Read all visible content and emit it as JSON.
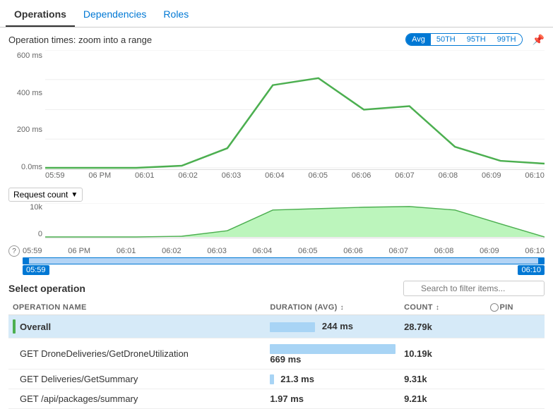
{
  "tabs": [
    {
      "label": "Operations",
      "active": true
    },
    {
      "label": "Dependencies",
      "active": false
    },
    {
      "label": "Roles",
      "active": false
    }
  ],
  "chart": {
    "title": "Operation times: zoom into a range",
    "percentiles": [
      "Avg",
      "50TH",
      "95TH",
      "99TH"
    ],
    "active_percentile": "Avg",
    "y_labels": [
      "600 ms",
      "400 ms",
      "200 ms",
      "0.0ms"
    ],
    "x_labels": [
      "05:59",
      "06 PM",
      "06:01",
      "06:02",
      "06:03",
      "06:04",
      "06:05",
      "06:06",
      "06:07",
      "06:08",
      "06:09",
      "06:10"
    ]
  },
  "mini_chart": {
    "dropdown_label": "Request count",
    "y_labels": [
      "10k",
      "0"
    ],
    "x_labels": [
      "05:59",
      "06 PM",
      "06:01",
      "06:02",
      "06:03",
      "06:04",
      "06:05",
      "06:06",
      "06:07",
      "06:08",
      "06:09",
      "06:10"
    ]
  },
  "range": {
    "start": "05:59",
    "end": "06:10"
  },
  "select_operation": {
    "title": "Select operation",
    "search_placeholder": "Search to filter items..."
  },
  "table": {
    "columns": [
      {
        "key": "name",
        "label": "OPERATION NAME"
      },
      {
        "key": "duration",
        "label": "DURATION (AVG)",
        "sortable": true
      },
      {
        "key": "count",
        "label": "COUNT",
        "sortable": true
      },
      {
        "key": "pin",
        "label": "PIN"
      }
    ],
    "rows": [
      {
        "name": "Overall",
        "duration": "244 ms",
        "duration_pct": 36,
        "count": "28.79k",
        "selected": true
      },
      {
        "name": "GET DroneDeliveries/GetDroneUtilization",
        "duration": "669 ms",
        "duration_pct": 100,
        "count": "10.19k",
        "selected": false
      },
      {
        "name": "GET Deliveries/GetSummary",
        "duration": "21.3 ms",
        "duration_pct": 3,
        "count": "9.31k",
        "selected": false
      },
      {
        "name": "GET /api/packages/summary",
        "duration": "1.97 ms",
        "duration_pct": 0,
        "count": "9.21k",
        "selected": false
      }
    ]
  }
}
